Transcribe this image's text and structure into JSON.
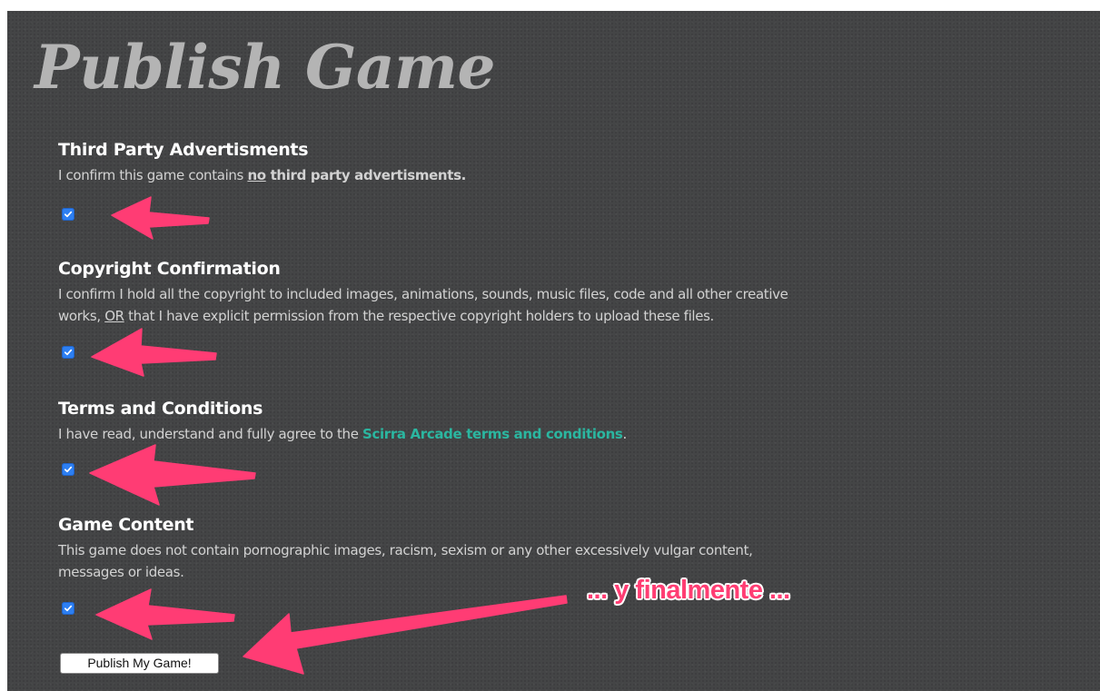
{
  "page": {
    "title": "Publish Game"
  },
  "sections": [
    {
      "heading": "Third Party Advertisments",
      "text_before": "I confirm this game contains ",
      "text_underline": "no",
      "text_after": " third party advertisments.",
      "checked": true
    },
    {
      "heading": "Copyright Confirmation",
      "text_line1": "I confirm I hold all the copyright to included images, animations, sounds, music files, code and all other creative",
      "text_line2_before": "works, ",
      "text_line2_underline": "OR",
      "text_line2_after": " that I have explicit permission from the respective copyright holders to upload these files.",
      "checked": true
    },
    {
      "heading": "Terms and Conditions",
      "text_before": "I have read, understand and fully agree to the ",
      "link_text": "Scirra Arcade terms and conditions",
      "text_after": ".",
      "checked": true
    },
    {
      "heading": "Game Content",
      "text_line1": "This game does not contain pornographic images, racism, sexism or any other excessively vulgar content,",
      "text_line2": "messages or ideas.",
      "checked": true
    }
  ],
  "publish_button": {
    "label": "Publish My Game!"
  },
  "annotation": {
    "text": "... y finalmente ..."
  },
  "colors": {
    "background": "#444546",
    "title": "#b4b4b4",
    "link": "#2bb6a0",
    "checkbox": "#2d7ff2",
    "arrow": "#ff3d73"
  },
  "icons": {
    "checkmark": "checkmark-icon",
    "arrow": "arrow-left-icon"
  }
}
